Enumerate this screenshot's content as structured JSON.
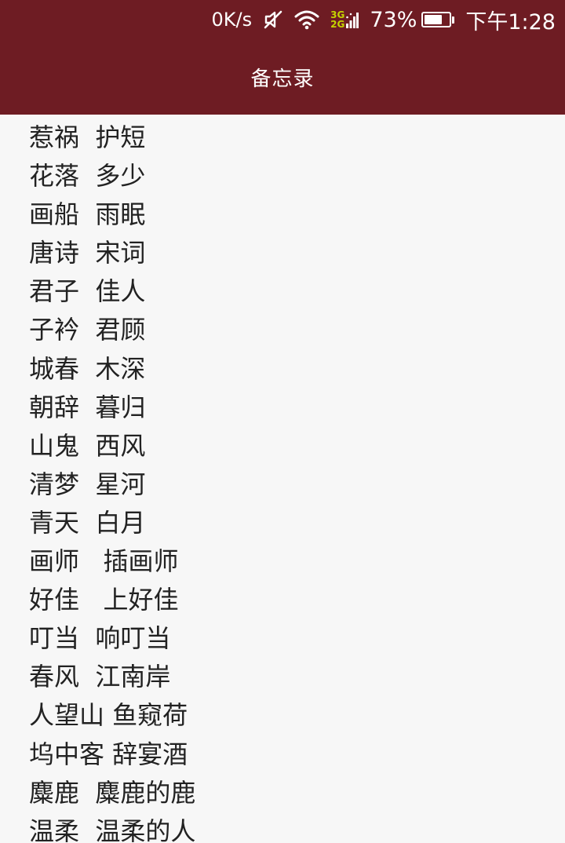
{
  "status_bar": {
    "net_speed": "0K/s",
    "network_top": "3G",
    "network_bottom": "2G",
    "battery_percent_text": "73%",
    "battery_level": 0.73,
    "time": "下午1:28",
    "icons": [
      "mute-icon",
      "wifi-icon",
      "cellular-signal-icon",
      "battery-icon"
    ]
  },
  "app_bar": {
    "title": "备忘录"
  },
  "memo_list": [
    "惹祸  护短",
    "花落  多少",
    "画船  雨眠",
    "唐诗  宋词",
    "君子  佳人",
    "子衿  君顾",
    "城春  木深",
    "朝辞  暮归",
    "山鬼  西风",
    "清梦  星河",
    "青天  白月",
    "画师   插画师",
    "好佳   上好佳",
    "叮当  响叮当",
    "春风  江南岸",
    "人望山 鱼窥荷",
    "坞中客 辞宴酒",
    "麋鹿  麋鹿的鹿",
    "温柔  温柔的人"
  ],
  "colors": {
    "primary": "#6e1c23",
    "background": "#f7f7f7",
    "text": "#222222"
  }
}
